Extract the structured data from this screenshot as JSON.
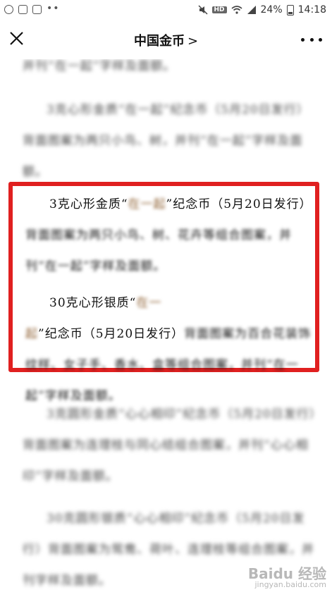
{
  "status_bar": {
    "battery_percent": "24%",
    "time": "14:18",
    "hd_badge": "HD",
    "network": "4G",
    "left_icons": [
      "wechat-icon",
      "image-icon",
      "folder-icon",
      "more-dots-icon"
    ],
    "right_icons": [
      "mute-icon",
      "hd-icon",
      "wifi-icon",
      "signal-icon",
      "battery-icon"
    ]
  },
  "nav": {
    "title": "中国金币",
    "title_chevron": ">",
    "close_icon": "close-icon",
    "more_icon": "more-icon"
  },
  "article": {
    "highlight": {
      "para1_prefix": "3克心形金质“",
      "para1_blur1": "在一起",
      "para1_mid": "”纪念币（5月20日发行）",
      "para1_blur2": "背面图案为两只小鸟、树、花卉等组合图案，并刊“在一起”字样及面额。",
      "para2_prefix": "30克心形银质“",
      "para2_blur1": "在一起",
      "para2_mid": "”纪念币（5月20日发行）",
      "para2_blur2": "背面图案为百合花装饰纹样、女子手、香水、盒等组合图案，并刊“在一起”字样及面额。"
    },
    "blurred_top": [
      "并刊“在一起”字样及面额。",
      "3克心形金质“在一起”纪念币（5月20日发行）背面图案为两只小鸟、树，并刊“在一起”字样及面额。"
    ],
    "blurred_bottom": [
      "3克圆形金质“心心相印”纪念币（5月20日发行）背面图案为连理枝与同心结组合图案，并刊“心心相印”字样及面额。",
      "30克圆形银质“心心相印”纪念币（5月20日发行）背面图案为鸳鸯、荷叶、连理枝等组合图案，并刊字样及面额。"
    ]
  },
  "watermark": {
    "brand": "Baidu 经验",
    "url": "jingyan.baidu.com"
  },
  "colors": {
    "highlight_border": "#e02020"
  }
}
